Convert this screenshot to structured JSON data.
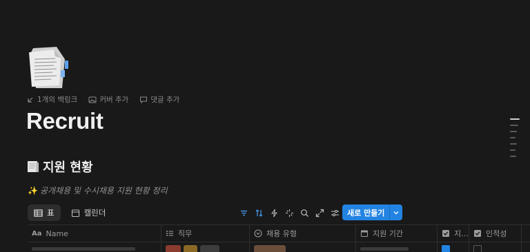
{
  "page": {
    "title": "Recruit",
    "meta": {
      "backlinks": "1개의 백링크",
      "add_cover": "커버 추가",
      "add_comment": "댓글 추가"
    },
    "section_title": "지원 현황",
    "description": "공개채용 및 수시채용 지원 현황 정리"
  },
  "views": {
    "tabs": [
      {
        "label": "표",
        "icon": "table-icon",
        "active": true
      },
      {
        "label": "캘린더",
        "icon": "calendar-icon",
        "active": false
      }
    ]
  },
  "toolbar": {
    "icons": [
      "filter-icon",
      "sort-icon",
      "automation-icon",
      "ai-sparkle-icon",
      "search-icon",
      "expand-icon",
      "settings-sliders-icon"
    ],
    "new_button": "새로 만들기"
  },
  "table": {
    "columns": [
      {
        "label": "Name",
        "icon": "text-aa-icon"
      },
      {
        "label": "직무",
        "icon": "list-icon"
      },
      {
        "label": "채용 유형",
        "icon": "select-icon"
      },
      {
        "label": "지원 기간",
        "icon": "calendar-icon"
      },
      {
        "label": "지...",
        "icon": "checkbox-icon"
      },
      {
        "label": "인적성",
        "icon": "checkbox-icon"
      }
    ]
  },
  "colors": {
    "background": "#191919",
    "accent": "#2383e2",
    "muted_text": "#8a8a8a"
  }
}
